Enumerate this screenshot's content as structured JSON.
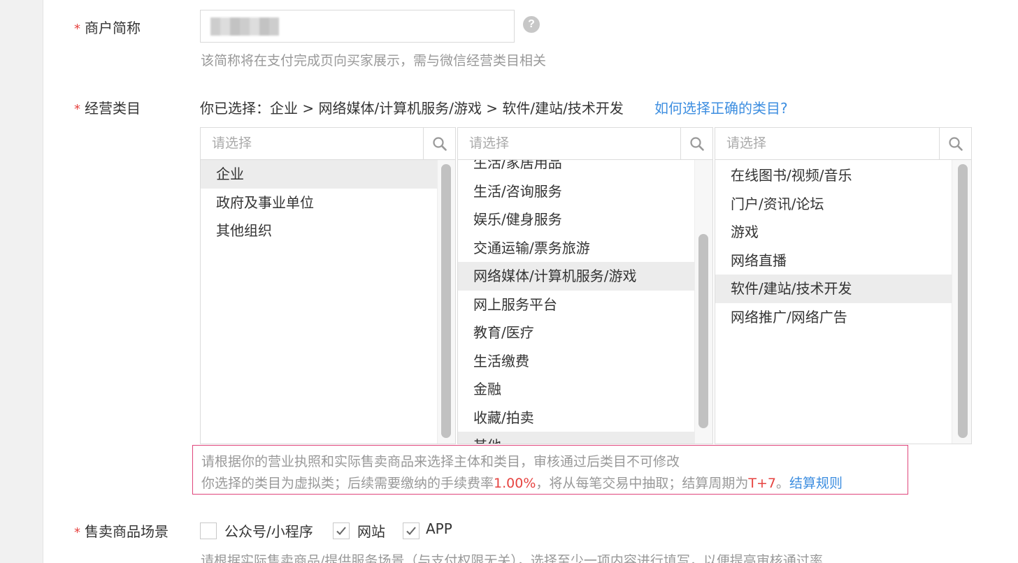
{
  "merchant_name": {
    "label": "商户简称",
    "required_mark": "*",
    "hint": "该简称将在支付完成页向买家展示，需与微信经营类目相关",
    "help_glyph": "?"
  },
  "category": {
    "label": "经营类目",
    "required_mark": "*",
    "selected_prefix": "你已选择：",
    "selected_path": "企业 > 网络媒体/计算机服务/游戏 > 软件/建站/技术开发",
    "help_link": "如何选择正确的类目?",
    "columns": [
      {
        "placeholder": "请选择",
        "items": [
          "企业",
          "政府及事业单位",
          "其他组织"
        ],
        "selected": "企业"
      },
      {
        "placeholder": "请选择",
        "items": [
          "生活/家居用品",
          "生活/咨询服务",
          "娱乐/健身服务",
          "交通运输/票务旅游",
          "网络媒体/计算机服务/游戏",
          "网上服务平台",
          "教育/医疗",
          "生活缴费",
          "金融",
          "收藏/拍卖",
          "其他"
        ],
        "selected": "网络媒体/计算机服务/游戏"
      },
      {
        "placeholder": "请选择",
        "items": [
          "在线图书/视频/音乐",
          "门户/资讯/论坛",
          "游戏",
          "网络直播",
          "软件/建站/技术开发",
          "网络推广/网络广告"
        ],
        "selected": "软件/建站/技术开发"
      }
    ],
    "notice": {
      "line1": "请根据你的营业执照和实际售卖商品来选择主体和类目，审核通过后类目不可修改",
      "line2_a": "你选择的类目为虚拟类；后续需要缴纳的手续费率",
      "fee_rate": "1.00%",
      "line2_b": "，将从每笔交易中抽取；结算周期为",
      "settle_cycle": "T+7",
      "line2_c": "。",
      "rule_link": "结算规则"
    }
  },
  "sale_scene": {
    "label": "售卖商品场景",
    "required_mark": "*",
    "options": [
      {
        "label": "公众号/小程序",
        "checked": false
      },
      {
        "label": "网站",
        "checked": true
      },
      {
        "label": "APP",
        "checked": true
      }
    ],
    "hint": "请根据实际售卖商品/提供服务场景（与支付权限无关），选择至少一项内容进行填写，以便提高审核通过率"
  },
  "colors": {
    "required": "#e64340",
    "link": "#3d8ee0",
    "highlight_border": "#e0457b",
    "selected_row": "#ececec"
  }
}
